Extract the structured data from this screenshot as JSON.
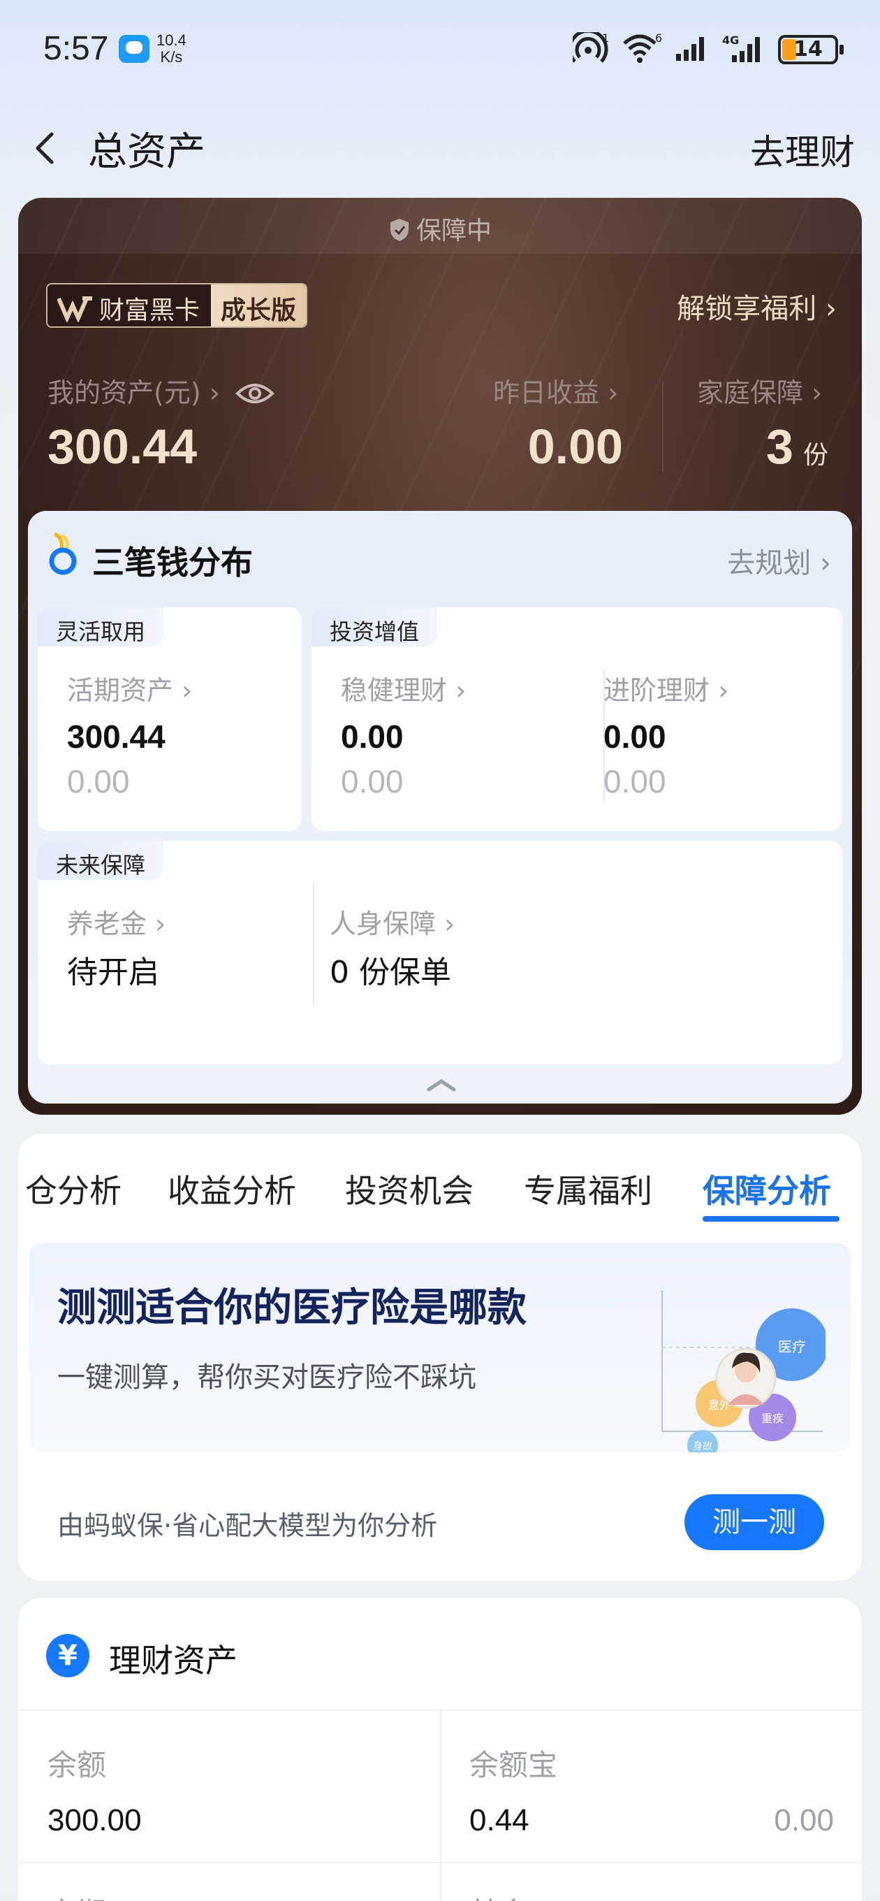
{
  "status_bar": {
    "time": "5:57",
    "net_speed_value": "10.4",
    "net_speed_unit": "K/s",
    "hotspot_sup": "1",
    "wifi_sup": "6",
    "signal2_label": "4G",
    "battery": "14"
  },
  "header": {
    "title": "总资产",
    "right_action": "去理财"
  },
  "wealth_card": {
    "status_label": "保障中",
    "badge_main": "财富黑卡",
    "badge_edition": "成长版",
    "unlock_link": "解锁享福利 ›",
    "my_assets_label": "我的资产(元) ›",
    "my_assets_value": "300.44",
    "yesterday_label": "昨日收益 ›",
    "yesterday_value": "0.00",
    "family_label": "家庭保障 ›",
    "family_value": "3",
    "family_unit": "份"
  },
  "three_money": {
    "title": "三笔钱分布",
    "plan_link": "去规划 ›",
    "flexible": {
      "tag": "灵活取用",
      "item_label": "活期资产 ›",
      "item_value": "300.44",
      "item_sub": "0.00"
    },
    "investment": {
      "tag": "投资增值",
      "steady_label": "稳健理财 ›",
      "steady_value": "0.00",
      "steady_sub": "0.00",
      "advanced_label": "进阶理财 ›",
      "advanced_value": "0.00",
      "advanced_sub": "0.00"
    },
    "future": {
      "tag": "未来保障",
      "pension_label": "养老金 ›",
      "pension_value": "待开启",
      "personal_label": "人身保障 ›",
      "personal_value": "0 份保单"
    }
  },
  "analysis_tabs": {
    "tabs": [
      "仓分析",
      "收益分析",
      "投资机会",
      "专属福利",
      "保障分析"
    ],
    "active_tab": "保障分析"
  },
  "insurance_promo": {
    "title": "测测适合你的医疗险是哪款",
    "subtitle": "一键测算，帮你买对医疗险不踩坑",
    "bubble_labels": [
      "医疗",
      "意外",
      "重疾",
      "身故"
    ],
    "footer": "由蚂蚁保·省心配大模型为你分析",
    "button": "测一测"
  },
  "wealth_assets": {
    "title": "理财资产",
    "icon_glyph": "¥",
    "rows": [
      {
        "label": "余额",
        "value": "300.00"
      },
      {
        "label": "余额宝",
        "value": "0.44",
        "extra": "0.00"
      }
    ],
    "partial_labels": [
      "定期",
      "基金"
    ]
  },
  "colors": {
    "accent_blue": "#1677ff",
    "card_gold": "#f4e1cc",
    "card_bg": "#3a241d"
  }
}
